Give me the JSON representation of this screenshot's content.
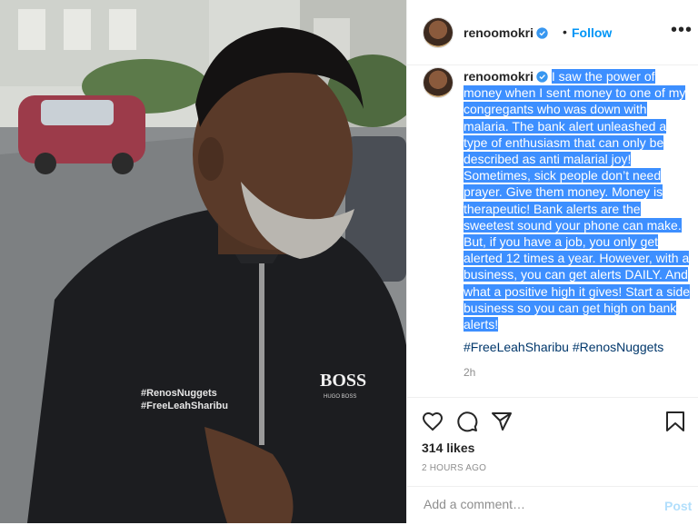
{
  "post": {
    "author": {
      "username": "renoomokri",
      "verified": true,
      "follow_label": "Follow",
      "separator": "•",
      "more_label": "•••"
    },
    "photo": {
      "jacket_text_line1": "#RenosNuggets",
      "jacket_text_line2": "#FreeLeahSharibu",
      "brand_text": "BOSS",
      "brand_subtext": "HUGO BOSS"
    },
    "caption": {
      "username": "renoomokri",
      "text": "I saw the power of money when I sent money to one of my congregants who was down with malaria. The bank alert unleashed a type of enthusiasm that can only be described as anti malarial joy! Sometimes, sick people don’t need prayer. Give them money. Money is therapeutic! Bank alerts are the sweetest sound your phone can make. But, if you have a job, you only get alerted 12 times a year. However, with a business, you can get alerts DAILY. And what a positive high it gives! Start a side business so you can get high on bank alerts!",
      "hashtag1": "#FreeLeahSharibu",
      "hashtag2": "#RenosNuggets",
      "age": "2h"
    },
    "engagement": {
      "likes": "314 likes",
      "timestamp": "2 HOURS AGO"
    },
    "comment_box": {
      "placeholder": "Add a comment…",
      "post_label": "Post"
    }
  },
  "colors": {
    "accent": "#0095f6",
    "selection": "#3d8fff",
    "hashtag": "#00376b",
    "muted": "#8e8e8e"
  },
  "icons": [
    "verified-badge-icon",
    "more-options-icon",
    "heart-icon",
    "comment-icon",
    "share-icon",
    "bookmark-icon"
  ]
}
